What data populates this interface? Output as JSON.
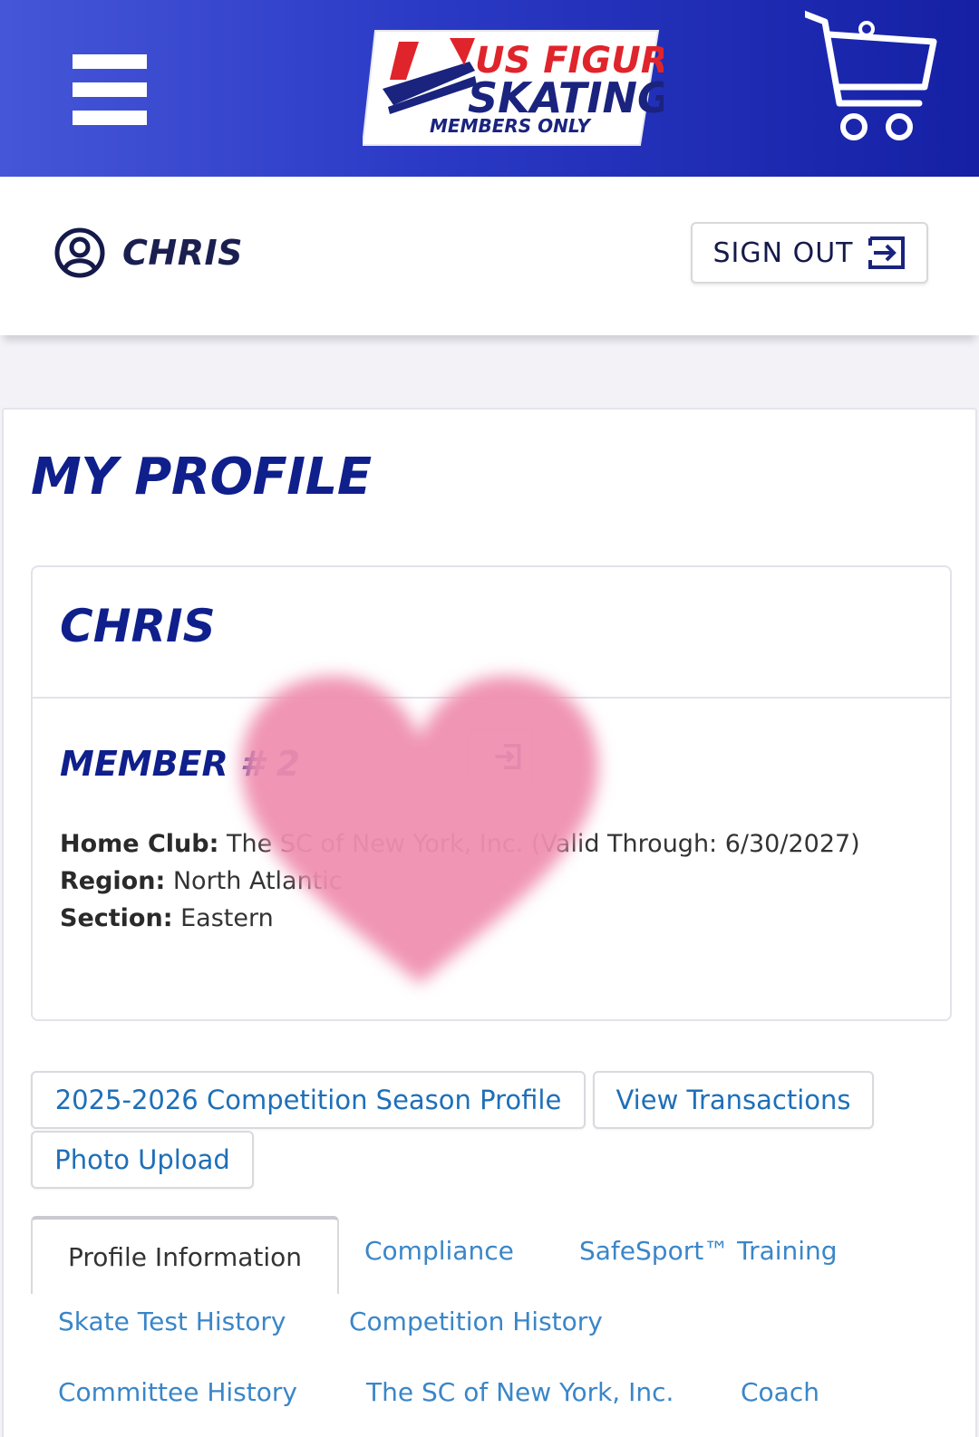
{
  "header": {
    "logo": {
      "line1": "US FIGURE",
      "line2": "SKATING",
      "line3": "MEMBERS ONLY",
      "brand_red": "#e0242b",
      "brand_navy": "#1a237e"
    },
    "menu_icon": "hamburger-icon",
    "cart_icon": "cart-icon",
    "colors": {
      "gradient_start": "#4656d8",
      "gradient_end": "#1520a4"
    }
  },
  "user": {
    "name": "CHRIS",
    "avatar_icon": "user-circle-icon",
    "sign_out_label": "SIGN OUT",
    "sign_out_icon": "sign-out-icon"
  },
  "profile": {
    "page_title": "MY PROFILE",
    "card_name": "CHRIS",
    "member_label": "MEMBER # 2",
    "copy_icon": "copy-icon",
    "home_club_label": "Home Club:",
    "home_club_value": "The SC of New York, Inc. (Valid Through: 6/30/2027)",
    "region_label": "Region:",
    "region_value": "North Atlantic",
    "section_label": "Section:",
    "section_value": "Eastern",
    "redaction": "pink-heart-sticker"
  },
  "actions": {
    "season_profile": "2025-2026 Competition Season Profile",
    "view_transactions": "View Transactions",
    "photo_upload": "Photo Upload"
  },
  "tabs": {
    "profile_information": "Profile Information",
    "compliance": "Compliance",
    "safesport": "SafeSport™ Training",
    "skate_test_history": "Skate Test History",
    "competition_history": "Competition History",
    "committee_history": "Committee History",
    "club": "The SC of New York, Inc.",
    "coach": "Coach"
  }
}
